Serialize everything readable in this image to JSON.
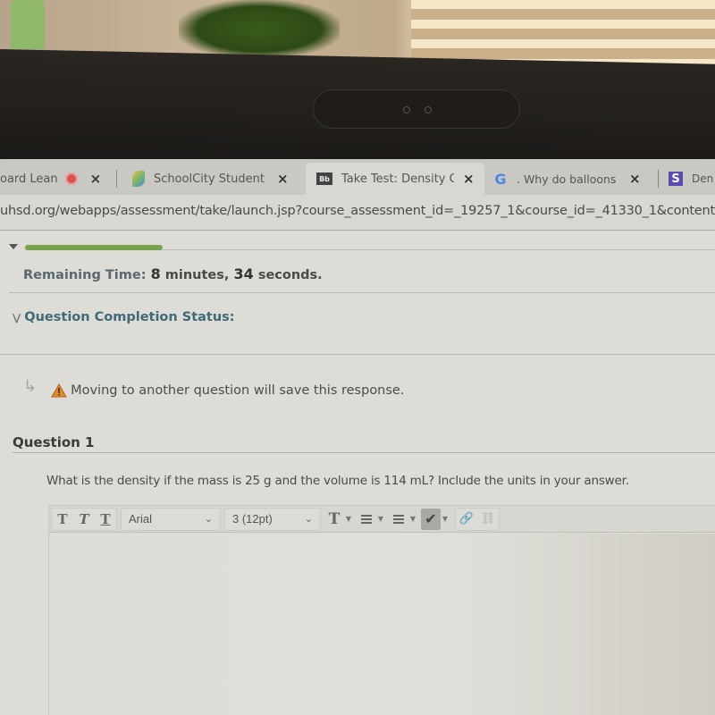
{
  "browser": {
    "tabs": [
      {
        "title": "oard Lean",
        "favicon": "recording-dot-icon",
        "close": "×",
        "active": false
      },
      {
        "title": "SchoolCity Student |",
        "favicon": "schoolcity-icon",
        "close": "×",
        "active": false
      },
      {
        "title": "Take Test: Density Qu",
        "favicon": "blackboard-icon",
        "favicon_text": "Bb",
        "close": "×",
        "active": true
      },
      {
        "title": ". Why do balloons g",
        "favicon": "google-icon",
        "favicon_text": "G",
        "close": "×",
        "active": false
      },
      {
        "title": "Den",
        "favicon": "s-icon",
        "favicon_text": "S",
        "active": false
      }
    ],
    "url": "uhsd.org/webapps/assessment/take/launch.jsp?course_assessment_id=_19257_1&course_id=_41330_1&content"
  },
  "test": {
    "progress_fraction": 0.2,
    "remaining_time": {
      "label": "Remaining Time:",
      "minutes": "8",
      "minutes_unit": "minutes,",
      "seconds": "34",
      "seconds_unit": "seconds."
    },
    "completion_status_label": "Question Completion Status:",
    "save_notice": "Moving to another question will save this response.",
    "question": {
      "title": "Question 1",
      "text": "What is the density if the mass is 25 g and the volume is 114 mL?  Include the units in your answer."
    }
  },
  "editor": {
    "toolbar": {
      "bold": "T",
      "italic": "T",
      "underline": "T",
      "font_family": "Arial",
      "font_size": "3 (12pt)",
      "text_color": "T",
      "spellcheck_label": "ABC",
      "link": "🔗",
      "unlink": "⛓"
    },
    "body_text": ""
  },
  "colors": {
    "progress": "#7aa24f",
    "status_heading": "#3f6a78",
    "warning": "#e08a2e"
  }
}
